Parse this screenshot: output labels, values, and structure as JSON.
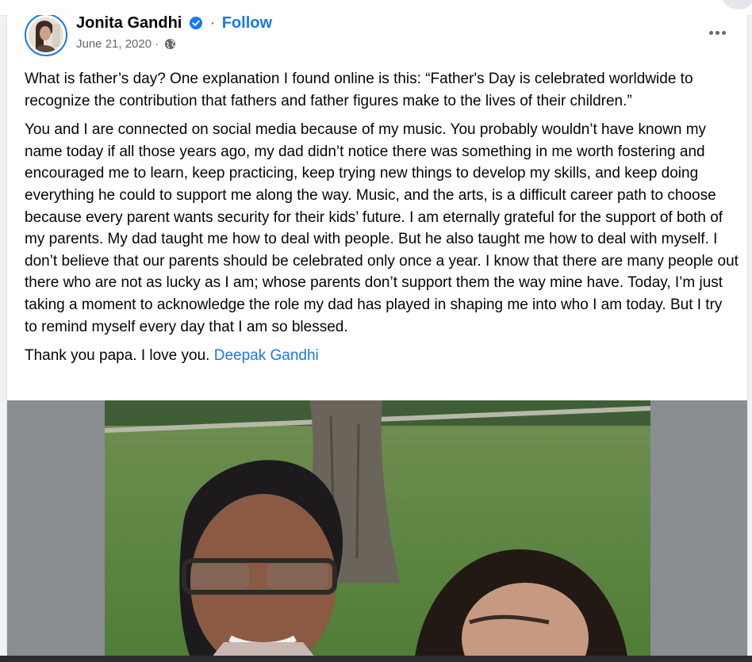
{
  "post": {
    "author": "Jonita Gandhi",
    "follow_label": "Follow",
    "separator": "·",
    "date": "June 21, 2020",
    "date_separator": "·",
    "verified_icon": "verified-badge-icon",
    "privacy_icon": "globe-icon",
    "more_icon": "more-options-icon",
    "paragraphs": [
      "What is father’s day? One explanation I found online is this: “Father's Day is celebrated worldwide to recognize the contribution that fathers and father figures make to the lives of their children.”",
      "You and I are connected on social media because of my music. You probably wouldn’t have known my name today if all those years ago, my dad didn’t notice there was something in me worth fostering and encouraged me to learn, keep practicing, keep trying new things to develop my skills, and keep doing everything he could to support me along the way. Music, and the arts, is a difficult career path to choose because every parent wants security for their kids’ future. I am eternally grateful for the support of both of my parents. My dad taught me how to deal with people. But he also taught me how to deal with myself. I don’t believe that our parents should be celebrated only once a year. I know that there are many people out there who are not as lucky as I am; whose parents don’t support them the way mine have. Today, I’m just taking a moment to acknowledge the role my dad has played in shaping me into who I am today. But I try to remind myself every day that I am so blessed."
    ],
    "closing_text": "Thank you papa. I love you.",
    "mention": "Deepak Gandhi"
  },
  "colors": {
    "link": "#1877f2",
    "text": "#050505",
    "secondary": "#65676b",
    "photo_frame": "#8a8d91"
  }
}
